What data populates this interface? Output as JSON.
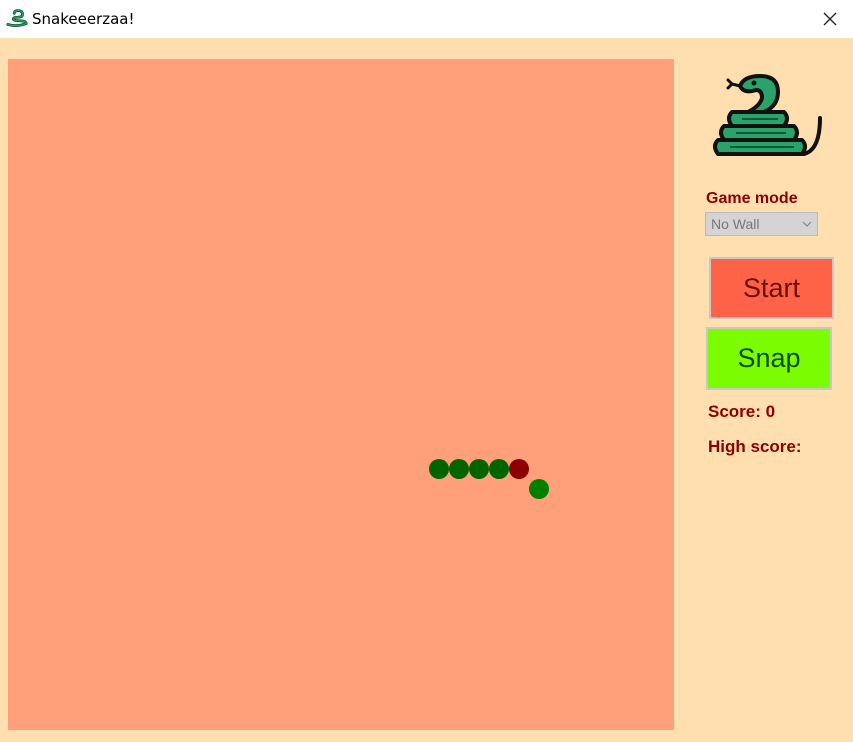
{
  "window": {
    "title": "Snakeeerzaa!"
  },
  "icons": {
    "app": "snake-icon",
    "close": "close-icon",
    "logo": "snake-logo-icon",
    "dropdown": "chevron-down-icon"
  },
  "sidebar": {
    "game_mode_label": "Game mode",
    "game_mode_value": "No Wall",
    "start_label": "Start",
    "snap_label": "Snap",
    "score_label": "Score: 0",
    "high_score_label": "High score:"
  },
  "board": {
    "cols": 33,
    "rows": 33,
    "snake": [
      {
        "col": 21,
        "row": 20,
        "part": "body"
      },
      {
        "col": 22,
        "row": 20,
        "part": "body"
      },
      {
        "col": 23,
        "row": 20,
        "part": "body"
      },
      {
        "col": 24,
        "row": 20,
        "part": "body"
      },
      {
        "col": 25,
        "row": 20,
        "part": "head"
      }
    ],
    "food": {
      "col": 26,
      "row": 21
    }
  },
  "colors": {
    "background": "#ffdfaf",
    "board": "#ffa07a",
    "snake_body": "#006400",
    "snake_head": "#8b0000",
    "food": "#008000",
    "start_button": "#ff6347",
    "snap_button": "#7cfc00",
    "label_text": "#8b0000"
  }
}
